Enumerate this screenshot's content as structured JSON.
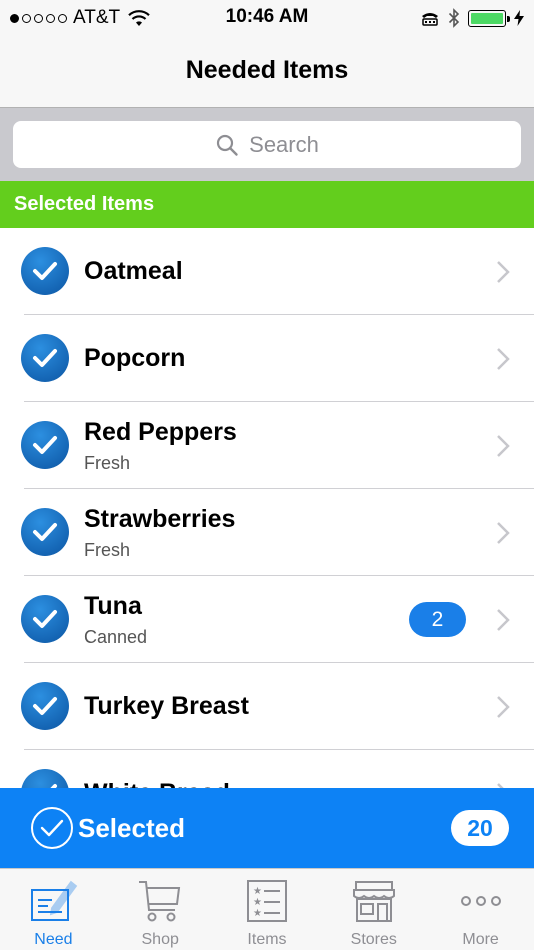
{
  "status_bar": {
    "carrier": "AT&T",
    "time": "10:46 AM",
    "battery_color": "#4cd964"
  },
  "nav": {
    "title": "Needed Items"
  },
  "search": {
    "placeholder": "Search",
    "icon": "search-icon"
  },
  "section": {
    "title": "Selected Items",
    "color": "#63ce1d"
  },
  "items": [
    {
      "name": "Oatmeal",
      "subtitle": ""
    },
    {
      "name": "Popcorn",
      "subtitle": ""
    },
    {
      "name": "Red Peppers",
      "subtitle": "Fresh"
    },
    {
      "name": "Strawberries",
      "subtitle": "Fresh"
    },
    {
      "name": "Tuna",
      "subtitle": "Canned",
      "badge": "2"
    },
    {
      "name": "Turkey Breast",
      "subtitle": ""
    },
    {
      "name": "White Bread",
      "subtitle": ""
    }
  ],
  "selected_bar": {
    "label": "Selected",
    "count": "20",
    "color": "#0d82f5"
  },
  "tabs": [
    {
      "label": "Need",
      "icon": "need-icon",
      "active": true
    },
    {
      "label": "Shop",
      "icon": "cart-icon"
    },
    {
      "label": "Items",
      "icon": "list-icon"
    },
    {
      "label": "Stores",
      "icon": "store-icon"
    },
    {
      "label": "More",
      "icon": "more-icon"
    }
  ]
}
